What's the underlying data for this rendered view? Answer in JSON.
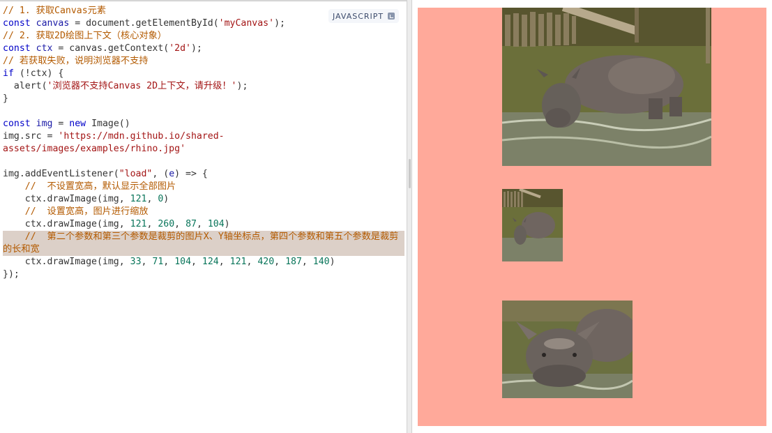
{
  "editor": {
    "language_badge": "JAVASCRIPT",
    "lines": {
      "l1": "// 1. 获取Canvas元素",
      "l2_kw": "const ",
      "l2_var": "canvas",
      "l2_rest": " = document.getElementById(",
      "l2_str": "'myCanvas'",
      "l2_end": ");",
      "l3": "// 2. 获取2D绘图上下文（核心对象）",
      "l4_kw": "const ",
      "l4_var": "ctx",
      "l4_rest": " = canvas.getContext(",
      "l4_str": "'2d'",
      "l4_end": ");",
      "l5": "// 若获取失败，说明浏览器不支持",
      "l6_kw": "if",
      "l6_rest": " (!ctx) {",
      "l7_rest": "  alert(",
      "l7_str": "'浏览器不支持Canvas 2D上下文，请升级！'",
      "l7_end": ");",
      "l8": "}",
      "l10_kw": "const ",
      "l10_var": "img",
      "l10_rest": " = ",
      "l10_new": "new",
      "l10_end": " Image()",
      "l11_rest": "img.src = ",
      "l11_str": "'https://mdn.github.io/shared-assets/images/examples/rhino.jpg'",
      "l13_rest": "img.addEventListener(",
      "l13_str": "\"load\"",
      "l13_mid": ", (",
      "l13_var": "e",
      "l13_end": ") => {",
      "l14": "    //  不设置宽高，默认显示全部图片",
      "l15_rest": "    ctx.drawImage(img, ",
      "l15_n1": "121",
      "l15_sep": ", ",
      "l15_n2": "0",
      "l15_end": ")",
      "l16": "    //  设置宽高，图片进行缩放",
      "l17_rest": "    ctx.drawImage(img, ",
      "l17_args": [
        "121",
        "260",
        "87",
        "104"
      ],
      "l17_end": ")",
      "l18": "    //  第二个参数和第三个参数是裁剪的图片X、Y轴坐标点，第四个参数和第五个参数是裁剪的长和宽",
      "l19_rest": "    ctx.drawImage(img, ",
      "l19_args": [
        "33",
        "71",
        "104",
        "124",
        "121",
        "420",
        "187",
        "140"
      ],
      "l19_end": ")",
      "l20": "});"
    }
  },
  "preview": {
    "canvas_bg": "#ffa99a",
    "images": [
      {
        "name": "rhino-full",
        "desc_icon": "rhino-image-icon"
      },
      {
        "name": "rhino-scaled",
        "desc_icon": "rhino-image-icon"
      },
      {
        "name": "rhino-cropped",
        "desc_icon": "rhino-image-icon"
      }
    ]
  }
}
